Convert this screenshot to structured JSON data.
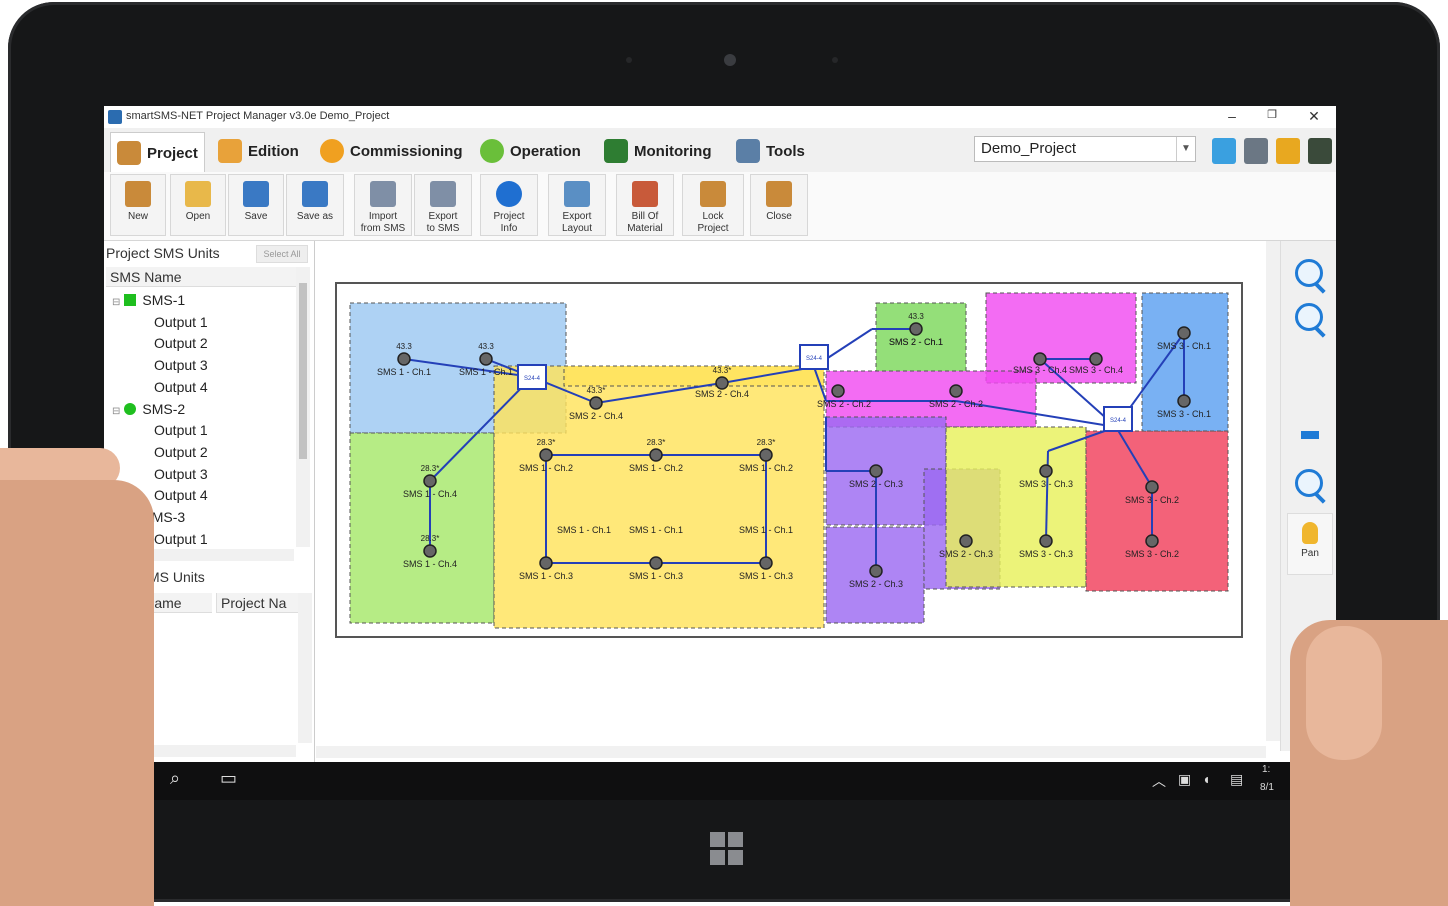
{
  "window": {
    "title": "smartSMS-NET Project Manager v3.0e   Demo_Project",
    "minimize": "–",
    "restore": "❐",
    "close": "✕"
  },
  "tabs": [
    {
      "label": "Project",
      "icon": "box-icon",
      "color": "#c98a3a"
    },
    {
      "label": "Edition",
      "icon": "pencil-ruler-icon",
      "color": "#e8a23a"
    },
    {
      "label": "Commissioning",
      "icon": "hardhat-icon",
      "color": "#f0a020"
    },
    {
      "label": "Operation",
      "icon": "gear-play-icon",
      "color": "#6abf3a"
    },
    {
      "label": "Monitoring",
      "icon": "monitor-icon",
      "color": "#2e7d32"
    },
    {
      "label": "Tools",
      "icon": "wrench-icon",
      "color": "#5b7fa6"
    }
  ],
  "project_selector": {
    "value": "Demo_Project"
  },
  "toolbar_icons": [
    "help-icon",
    "binoculars-icon",
    "lock-icon",
    "exit-icon"
  ],
  "ribbon": [
    {
      "label": "New",
      "icon": "box-icon",
      "color": "#c98a3a"
    },
    {
      "label": "Open",
      "icon": "folder-icon",
      "color": "#e8b84a"
    },
    {
      "label": "Save",
      "icon": "floppy-icon",
      "color": "#3a79c4"
    },
    {
      "label": "Save as",
      "icon": "floppy-icon",
      "color": "#3a79c4"
    },
    {
      "label": "Import\nfrom SMS",
      "icon": "import-icon",
      "color": "#7f8fa6"
    },
    {
      "label": "Export\nto SMS",
      "icon": "export-icon",
      "color": "#7f8fa6"
    },
    {
      "label": "Project\nInfo",
      "icon": "info-icon",
      "color": "#1f6fd1"
    },
    {
      "label": "Export\nLayout",
      "icon": "export-layout-icon",
      "color": "#5a8fc4"
    },
    {
      "label": "Bill Of\nMaterial",
      "icon": "checklist-icon",
      "color": "#c85a3a"
    },
    {
      "label": "Lock\nProject",
      "icon": "lock-box-icon",
      "color": "#c98a3a"
    },
    {
      "label": "Close",
      "icon": "box-icon",
      "color": "#c98a3a"
    }
  ],
  "left_panel": {
    "header": "Project SMS Units",
    "select_all": "Select All",
    "column": "SMS Name",
    "tree": [
      {
        "label": "SMS-1",
        "level": 0,
        "status": "#1fbf1f"
      },
      {
        "label": "Output 1",
        "level": 1
      },
      {
        "label": "Output 2",
        "level": 1
      },
      {
        "label": "Output 3",
        "level": 1
      },
      {
        "label": "Output 4",
        "level": 1
      },
      {
        "label": "SMS-2",
        "level": 0,
        "status": "#1fbf1f"
      },
      {
        "label": "Output 1",
        "level": 1
      },
      {
        "label": "Output 2",
        "level": 1
      },
      {
        "label": "Output 3",
        "level": 1
      },
      {
        "label": "Output 4",
        "level": 1
      },
      {
        "label": "SMS-3",
        "level": 0,
        "status": "#1fbf1f"
      },
      {
        "label": "Output 1",
        "level": 1
      }
    ],
    "free_header": "Free SMS Units",
    "free_columns": [
      "SMS Name",
      "Project Na"
    ]
  },
  "right_tools": {
    "pan_label": "Pan"
  },
  "floorplan": {
    "zones": [
      {
        "color": "#9cc8f2"
      },
      {
        "color": "#a6e86a"
      },
      {
        "color": "#ffe35c"
      },
      {
        "color": "#7cd85c"
      },
      {
        "color": "#f04cf0"
      },
      {
        "color": "#9c6af2"
      },
      {
        "color": "#e8f05c"
      },
      {
        "color": "#f0405c"
      },
      {
        "color": "#5ca0f0"
      }
    ],
    "labels": [
      "SMS 1 - Ch.1",
      "SMS 1 - Ch.1",
      "SMS 2 - Ch.4",
      "SMS 2 - Ch.4",
      "SMS 2 - Ch.1",
      "SMS 1 - Ch.2",
      "SMS 1 - Ch.2",
      "SMS 1 - Ch.2",
      "SMS 1 - Ch.4",
      "SMS 1 - Ch.4",
      "SMS 1 - Ch.1",
      "SMS 1 - Ch.1",
      "SMS 1 - Ch.1",
      "SMS 1 - Ch.3",
      "SMS 1 - Ch.3",
      "SMS 1 - Ch.3",
      "SMS 2 - Ch.1",
      "SMS 2 - Ch.2",
      "SMS 2 - Ch.2",
      "SMS 2 - Ch.3",
      "SMS 2 - Ch.3",
      "SMS 2 - Ch.3",
      "SMS 3 - Ch.4",
      "SMS 3 - Ch.4",
      "SMS 3 - Ch.1",
      "SMS 3 - Ch.1",
      "SMS 3 - Ch.3",
      "SMS 3 - Ch.3",
      "SMS 3 - Ch.2",
      "SMS 3 - Ch.2"
    ],
    "sensor_values": [
      "43.3",
      "43.3*",
      "28.3*"
    ],
    "hubs": [
      "S24-4",
      "S24-4",
      "S24-4"
    ]
  },
  "taskbar": {
    "time": "1:",
    "date": "8/1"
  }
}
